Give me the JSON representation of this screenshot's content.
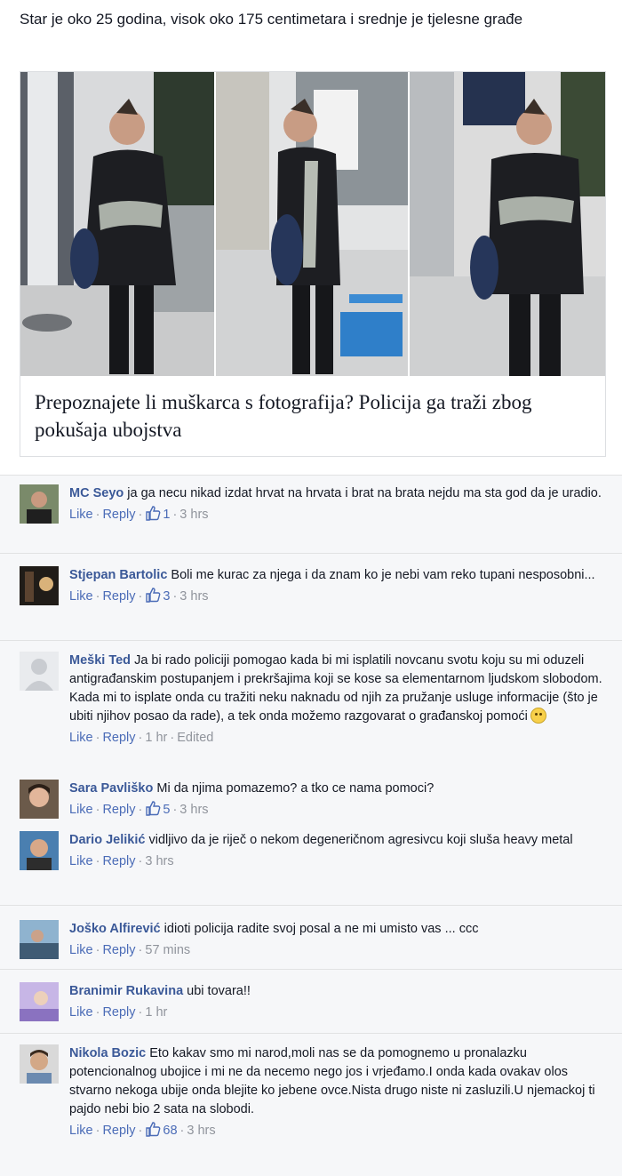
{
  "post": {
    "text": "Star je oko 25 godina, visok oko 175 centimetara i srednje je tjelesne građe",
    "link_title": "Prepoznajete li muškarca s fotografija? Policija ga traži zbog pokušaja ubojstva"
  },
  "comments": [
    {
      "name": "MC Seyo",
      "text": "ja ga necu nikad izdat hrvat na hrvata i brat na brata nejdu ma sta god da je uradio.",
      "like": "Like",
      "reply": "Reply",
      "likes": "1",
      "time": "3 hrs"
    },
    {
      "name": "Stjepan Bartolic",
      "text": "Boli me kurac za njega i da znam ko je nebi vam reko tupani nesposobni...",
      "like": "Like",
      "reply": "Reply",
      "likes": "3",
      "time": "3 hrs"
    },
    {
      "name": "Meški Ted",
      "text": "Ja bi rado policiji pomogao kada bi mi isplatili novcanu svotu koju su mi oduzeli antigrađanskim postupanjem i prekršajima koji se kose sa elementarnom ljudskom slobodom. Kada mi to isplate onda cu tražiti neku naknadu od njih za pružanje usluge informacije (što je ubiti njihov posao da rade), a tek onda možemo razgovarat o građanskoj pomoći",
      "like": "Like",
      "reply": "Reply",
      "time": "1 hr",
      "edited": "Edited"
    },
    {
      "name": "Sara Pavliško",
      "text": "Mi da njima pomazemo? a tko ce nama pomoci?",
      "like": "Like",
      "reply": "Reply",
      "likes": "5",
      "time": "3 hrs"
    },
    {
      "name": "Dario Jelikić",
      "text": "vidljivo da je riječ o nekom degeneričnom agresivcu koji sluša heavy metal",
      "like": "Like",
      "reply": "Reply",
      "time": "3 hrs"
    },
    {
      "name": "Joško Alfirević",
      "text": "idioti policija radite svoj posal a ne mi umisto vas ... ccc",
      "like": "Like",
      "reply": "Reply",
      "time": "57 mins"
    },
    {
      "name": "Branimir Rukavina",
      "text": "ubi tovara!!",
      "like": "Like",
      "reply": "Reply",
      "time": "1 hr"
    },
    {
      "name": "Nikola Bozic",
      "text": "Eto kakav smo mi narod,moli nas se da pomognemo u pronalazku potencionalnog ubojice i mi ne da necemo nego jos i vrjeđamo.I onda kada ovakav olos stvarno nekoga ubije onda blejite ko jebene ovce.Nista drugo niste ni zasluzili.U njemackoj ti pajdo nebi bio 2 sata na slobodi.",
      "like": "Like",
      "reply": "Reply",
      "likes": "68",
      "time": "3 hrs"
    }
  ],
  "colors": {
    "name": "#3b5998",
    "link": "#4b6cb7",
    "meta": "#90949c",
    "comments_bg": "#f6f7f9"
  }
}
